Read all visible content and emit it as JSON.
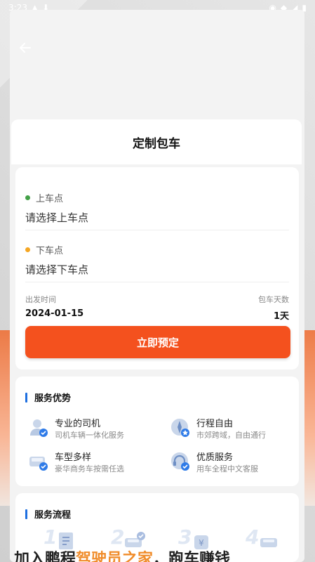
{
  "status_bar": {
    "time": "3:23"
  },
  "page": {
    "title": "定制包车"
  },
  "booking": {
    "pickup": {
      "label": "上车点",
      "placeholder": "请选择上车点",
      "dot_color": "#43a047"
    },
    "dropoff": {
      "label": "下车点",
      "placeholder": "请选择下车点",
      "dot_color": "#f5a623"
    },
    "departure": {
      "label": "出发时间",
      "value": "2024-01-15"
    },
    "days": {
      "label": "包车天数",
      "value": "1天"
    },
    "book_button": "立即预定"
  },
  "advantages": {
    "title": "服务优势",
    "items": [
      {
        "icon": "driver-icon",
        "title": "专业的司机",
        "subtitle": "司机车辆一体化服务"
      },
      {
        "icon": "compass-icon",
        "title": "行程自由",
        "subtitle": "市郊跨域，自由通行"
      },
      {
        "icon": "car-models-icon",
        "title": "车型多样",
        "subtitle": "豪华商务车按需任选"
      },
      {
        "icon": "headset-icon",
        "title": "优质服务",
        "subtitle": "用车全程中文客服"
      }
    ]
  },
  "process": {
    "title": "服务流程",
    "steps": [
      "1",
      "2",
      "3",
      "4"
    ]
  },
  "banner": {
    "text_a": "加入鹏程",
    "text_hl": "驾驶员之家",
    "text_b": "，跑车赚钱"
  },
  "colors": {
    "accent": "#f4511e",
    "section_bar": "#1e6fe0"
  }
}
